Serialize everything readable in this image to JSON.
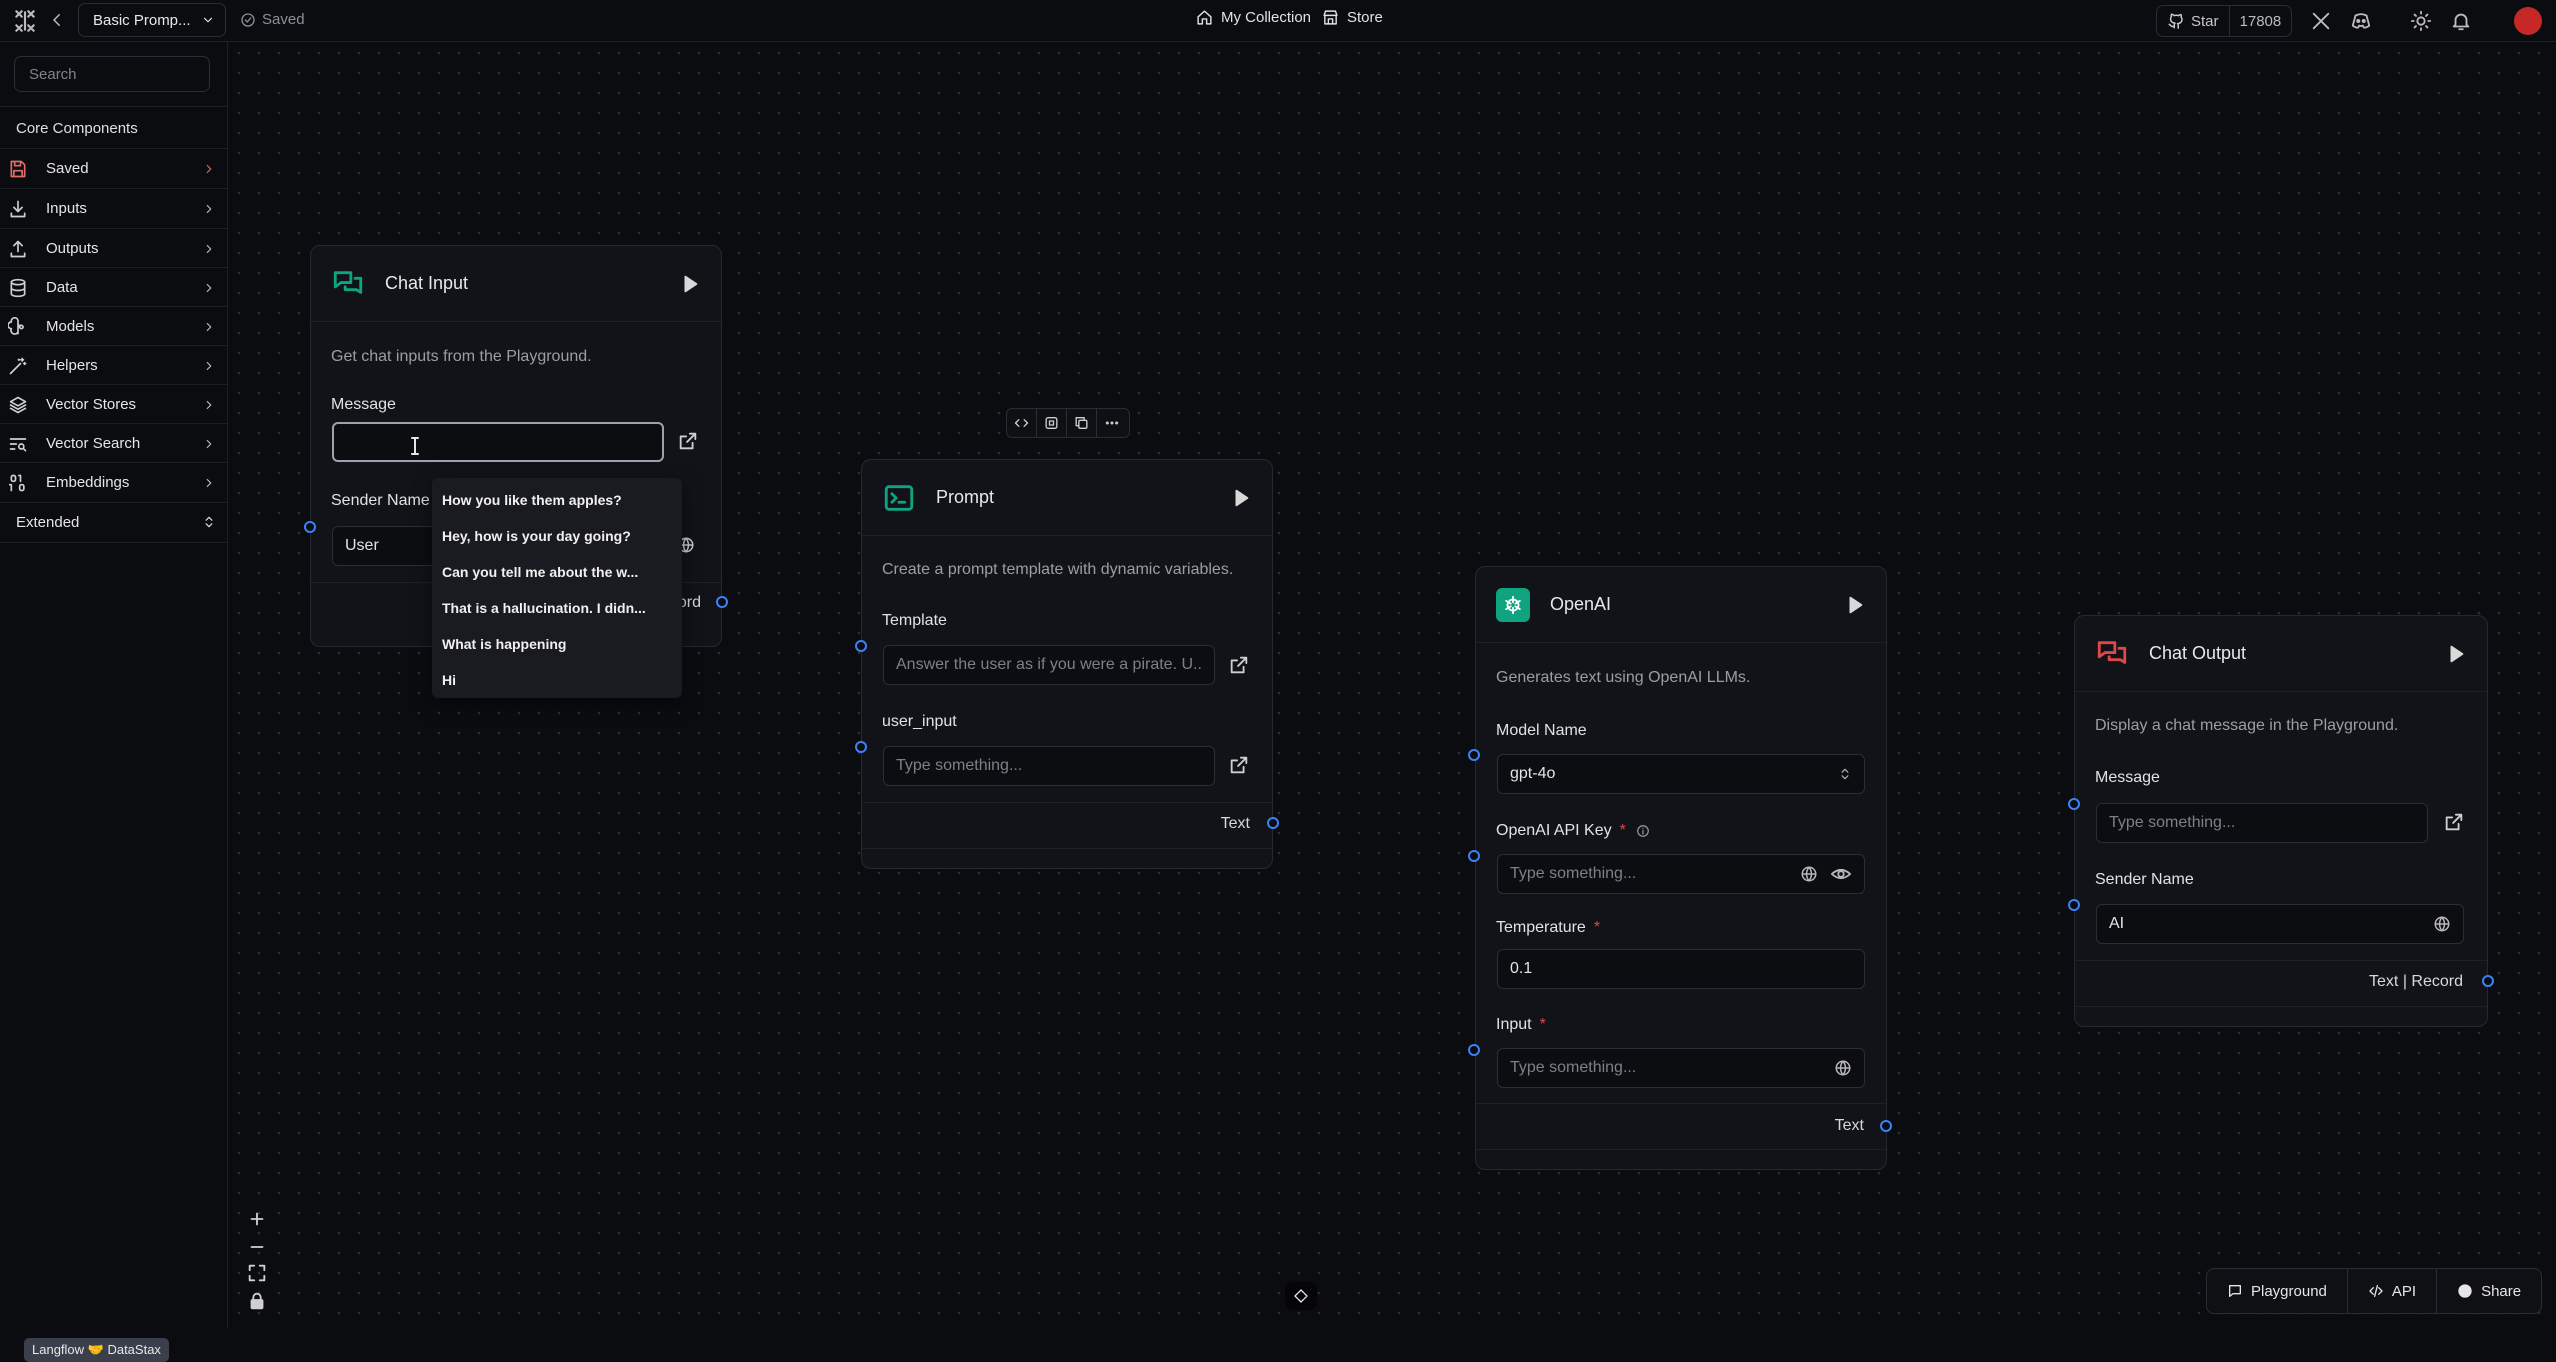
{
  "topbar": {
    "flow_name": "Basic Promp...",
    "saved_status": "Saved",
    "nav": [
      {
        "label": "My Collection",
        "icon": "home-icon"
      },
      {
        "label": "Store",
        "icon": "store-icon"
      }
    ],
    "github_star_label": "Star",
    "github_star_count": "17808"
  },
  "sidebar": {
    "search_placeholder": "Search",
    "section_title": "Core Components",
    "items": [
      {
        "label": "Saved",
        "icon": "saved-icon"
      },
      {
        "label": "Inputs",
        "icon": "download-icon"
      },
      {
        "label": "Outputs",
        "icon": "upload-icon"
      },
      {
        "label": "Data",
        "icon": "database-icon"
      },
      {
        "label": "Models",
        "icon": "brain-icon"
      },
      {
        "label": "Helpers",
        "icon": "wand-icon"
      },
      {
        "label": "Vector Stores",
        "icon": "layers-icon"
      },
      {
        "label": "Vector Search",
        "icon": "text-search-icon"
      },
      {
        "label": "Embeddings",
        "icon": "binary-icon"
      }
    ],
    "extended_label": "Extended"
  },
  "nodes": {
    "chat_input": {
      "title": "Chat Input",
      "description": "Get chat inputs from the Playground.",
      "message_label": "Message",
      "message_value": "",
      "sender_name_label": "Sender Name",
      "sender_name_value": "User",
      "output_label_partial": "ord"
    },
    "prompt": {
      "title": "Prompt",
      "description": "Create a prompt template with dynamic variables.",
      "template_label": "Template",
      "template_value": "Answer the user as if you were a pirate. U...",
      "user_input_label": "user_input",
      "user_input_placeholder": "Type something...",
      "output_label": "Text"
    },
    "openai": {
      "title": "OpenAI",
      "description": "Generates text using OpenAI LLMs.",
      "model_name_label": "Model Name",
      "model_name_value": "gpt-4o",
      "api_key_label": "OpenAI API Key",
      "api_key_placeholder": "Type something...",
      "temperature_label": "Temperature",
      "temperature_value": "0.1",
      "input_label": "Input",
      "input_placeholder": "Type something...",
      "output_label": "Text"
    },
    "chat_output": {
      "title": "Chat Output",
      "description": "Display a chat message in the Playground.",
      "message_label": "Message",
      "message_placeholder": "Type something...",
      "sender_name_label": "Sender Name",
      "sender_name_value": "AI",
      "output_label": "Text | Record"
    }
  },
  "suggestions": [
    "How you like them apples?",
    "Hey, how is your day going?",
    "Can you tell me about the w...",
    "That is a hallucination. I didn...",
    "What is happening",
    "Hi"
  ],
  "footer": {
    "badge": "Langflow 🤝 DataStax",
    "actions": [
      {
        "label": "Playground",
        "icon": "message-icon"
      },
      {
        "label": "API",
        "icon": "code-icon"
      },
      {
        "label": "Share",
        "icon": "share-icon"
      }
    ]
  },
  "colors": {
    "background": "#0b0c10",
    "node": "#111318",
    "handle": "#3b82f6",
    "accent_green": "#10a37f",
    "accent_red": "#e04848"
  }
}
